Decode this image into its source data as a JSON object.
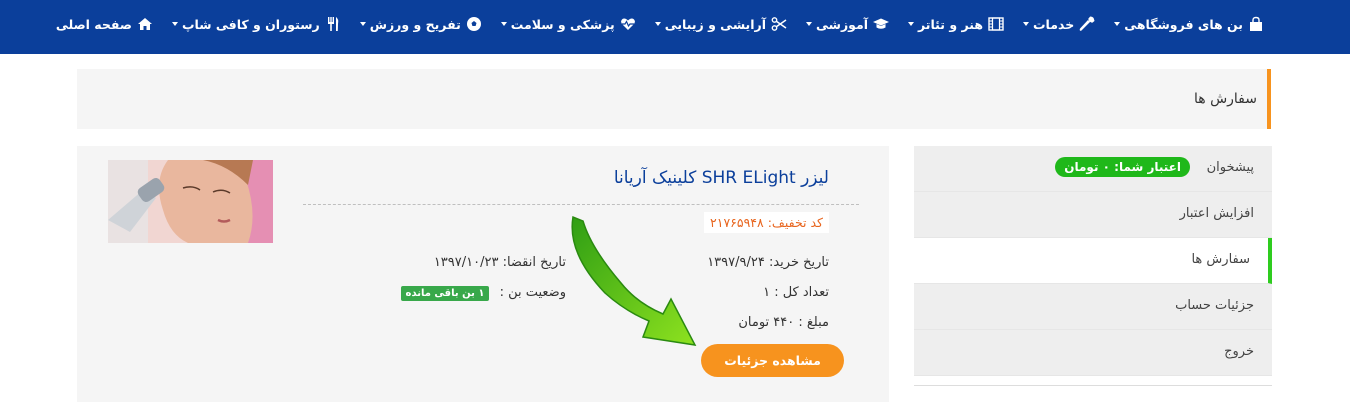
{
  "nav": {
    "items": [
      {
        "label": "صفحه اصلی",
        "icon": "home-icon",
        "caret": false
      },
      {
        "label": "رستوران و کافی شاپ",
        "icon": "utensils-icon",
        "caret": true
      },
      {
        "label": "تفریح و ورزش",
        "icon": "soccer-ball-icon",
        "caret": true
      },
      {
        "label": "پزشکی و سلامت",
        "icon": "heartbeat-icon",
        "caret": true
      },
      {
        "label": "آرایشی و زیبایی",
        "icon": "scissors-icon",
        "caret": true
      },
      {
        "label": "آموزشی",
        "icon": "graduation-cap-icon",
        "caret": true
      },
      {
        "label": "هنر و تئاتر",
        "icon": "film-icon",
        "caret": true
      },
      {
        "label": "خدمات",
        "icon": "wrench-icon",
        "caret": true
      },
      {
        "label": "بن های فروشگاهی",
        "icon": "shopping-bag-icon",
        "caret": true
      }
    ]
  },
  "page": {
    "title": "سفارش ها"
  },
  "sidebar": {
    "items": [
      {
        "label": "پیشخوان",
        "badge": "اعتبار شما: ۰ تومان",
        "active": false
      },
      {
        "label": "افزایش اعتبار",
        "active": false
      },
      {
        "label": "سفارش ها",
        "active": true
      },
      {
        "label": "جزئیات حساب",
        "active": false
      },
      {
        "label": "خروج",
        "active": false
      }
    ]
  },
  "order": {
    "title": "لیزر SHR ELight کلینیک آریانا",
    "discount_code": "کد تخفیف: ۲۱۷۶۵۹۴۸",
    "purchase_date": "تاریخ خرید: ۱۳۹۷/۹/۲۴",
    "total_count": "تعداد کل : ۱",
    "amount": "مبلغ : ۴۴۰ تومان",
    "expiry_date": "تاریخ انقضا: ۱۳۹۷/۱۰/۲۳",
    "status_label": "وضعیت بن :",
    "status_badge": "۱ بن باقی مانده",
    "details_button": "مشاهده جزئیات",
    "image_icon": "laser-treatment-photo"
  },
  "colors": {
    "nav_bg": "#0b3f9b",
    "accent_orange": "#f7931e",
    "active_green": "#2ecc1f",
    "credit_badge": "#1fb81a",
    "status_badge": "#38a84a",
    "arrow_green": "#5ccf1a"
  }
}
